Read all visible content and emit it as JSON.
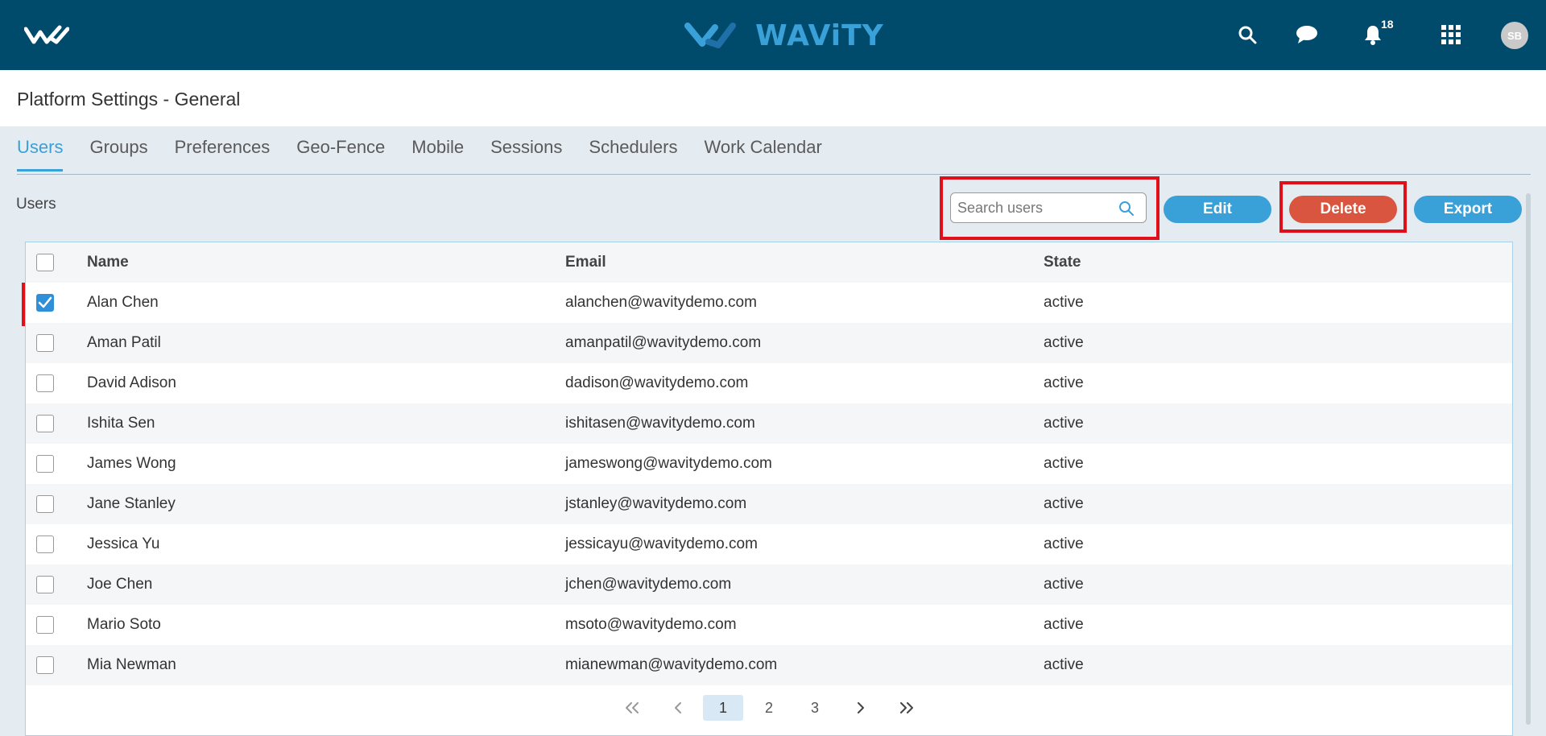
{
  "brand": {
    "name": "WAViTY",
    "accent": "#3aa0d8",
    "topbar_color": "#004a6b"
  },
  "topbar": {
    "notification_count": "18",
    "avatar_initials": "SB",
    "icons": [
      "home-logo-icon",
      "search-icon",
      "chat-icon",
      "bell-icon",
      "apps-grid-icon"
    ]
  },
  "page": {
    "title": "Platform Settings - General"
  },
  "tabs": [
    {
      "label": "Users",
      "active": true
    },
    {
      "label": "Groups"
    },
    {
      "label": "Preferences"
    },
    {
      "label": "Geo-Fence"
    },
    {
      "label": "Mobile"
    },
    {
      "label": "Sessions"
    },
    {
      "label": "Schedulers"
    },
    {
      "label": "Work Calendar"
    }
  ],
  "section": {
    "label": "Users"
  },
  "toolbar": {
    "search_placeholder": "Search users",
    "edit_label": "Edit",
    "delete_label": "Delete",
    "export_label": "Export",
    "delete_color": "#d9553f"
  },
  "table": {
    "headers": {
      "name": "Name",
      "email": "Email",
      "state": "State"
    },
    "rows": [
      {
        "name": "Alan Chen",
        "email": "alanchen@wavitydemo.com",
        "state": "active",
        "checked": true
      },
      {
        "name": "Aman Patil",
        "email": "amanpatil@wavitydemo.com",
        "state": "active"
      },
      {
        "name": "David Adison",
        "email": "dadison@wavitydemo.com",
        "state": "active"
      },
      {
        "name": "Ishita Sen",
        "email": "ishitasen@wavitydemo.com",
        "state": "active"
      },
      {
        "name": "James Wong",
        "email": "jameswong@wavitydemo.com",
        "state": "active"
      },
      {
        "name": "Jane Stanley",
        "email": "jstanley@wavitydemo.com",
        "state": "active"
      },
      {
        "name": "Jessica Yu",
        "email": "jessicayu@wavitydemo.com",
        "state": "active"
      },
      {
        "name": "Joe Chen",
        "email": "jchen@wavitydemo.com",
        "state": "active"
      },
      {
        "name": "Mario Soto",
        "email": "msoto@wavitydemo.com",
        "state": "active"
      },
      {
        "name": "Mia Newman",
        "email": "mianewman@wavitydemo.com",
        "state": "active"
      }
    ]
  },
  "pagination": {
    "first": "«",
    "prev": "‹",
    "pages": [
      "1",
      "2",
      "3"
    ],
    "current": "1",
    "next": "›",
    "last": "»"
  }
}
